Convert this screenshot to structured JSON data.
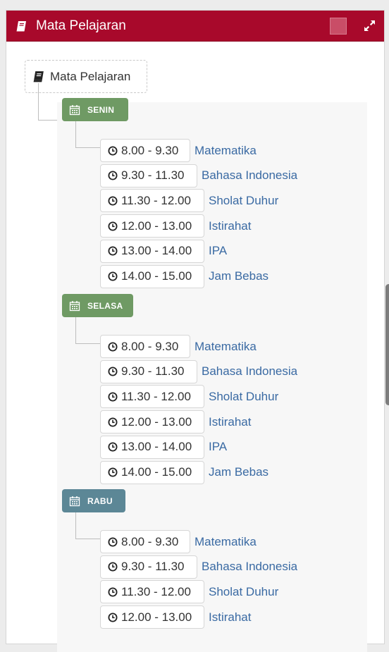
{
  "header": {
    "title": "Mata Pelajaran",
    "icon": "book-icon",
    "expand_icon": "expand-icon",
    "color": "#a8092b"
  },
  "tree": {
    "root_label": "Mata Pelajaran",
    "days": [
      {
        "name": "SENIN",
        "color": "#6f9a64",
        "slots": [
          {
            "time": "8.00 - 9.30",
            "subject": "Matematika"
          },
          {
            "time": "9.30 - 11.30",
            "subject": "Bahasa Indonesia"
          },
          {
            "time": "11.30 - 12.00",
            "subject": "Sholat Duhur"
          },
          {
            "time": "12.00 - 13.00",
            "subject": "Istirahat"
          },
          {
            "time": "13.00 - 14.00",
            "subject": "IPA"
          },
          {
            "time": "14.00 - 15.00",
            "subject": "Jam Bebas"
          }
        ]
      },
      {
        "name": "SELASA",
        "color": "#6f9a64",
        "slots": [
          {
            "time": "8.00 - 9.30",
            "subject": "Matematika"
          },
          {
            "time": "9.30 - 11.30",
            "subject": "Bahasa Indonesia"
          },
          {
            "time": "11.30 - 12.00",
            "subject": "Sholat Duhur"
          },
          {
            "time": "12.00 - 13.00",
            "subject": "Istirahat"
          },
          {
            "time": "13.00 - 14.00",
            "subject": "IPA"
          },
          {
            "time": "14.00 - 15.00",
            "subject": "Jam Bebas"
          }
        ]
      },
      {
        "name": "RABU",
        "color": "#5c8796",
        "slots": [
          {
            "time": "8.00 - 9.30",
            "subject": "Matematika"
          },
          {
            "time": "9.30 - 11.30",
            "subject": "Bahasa Indonesia"
          },
          {
            "time": "11.30 - 12.00",
            "subject": "Sholat Duhur"
          },
          {
            "time": "12.00 - 13.00",
            "subject": "Istirahat"
          }
        ]
      }
    ]
  }
}
